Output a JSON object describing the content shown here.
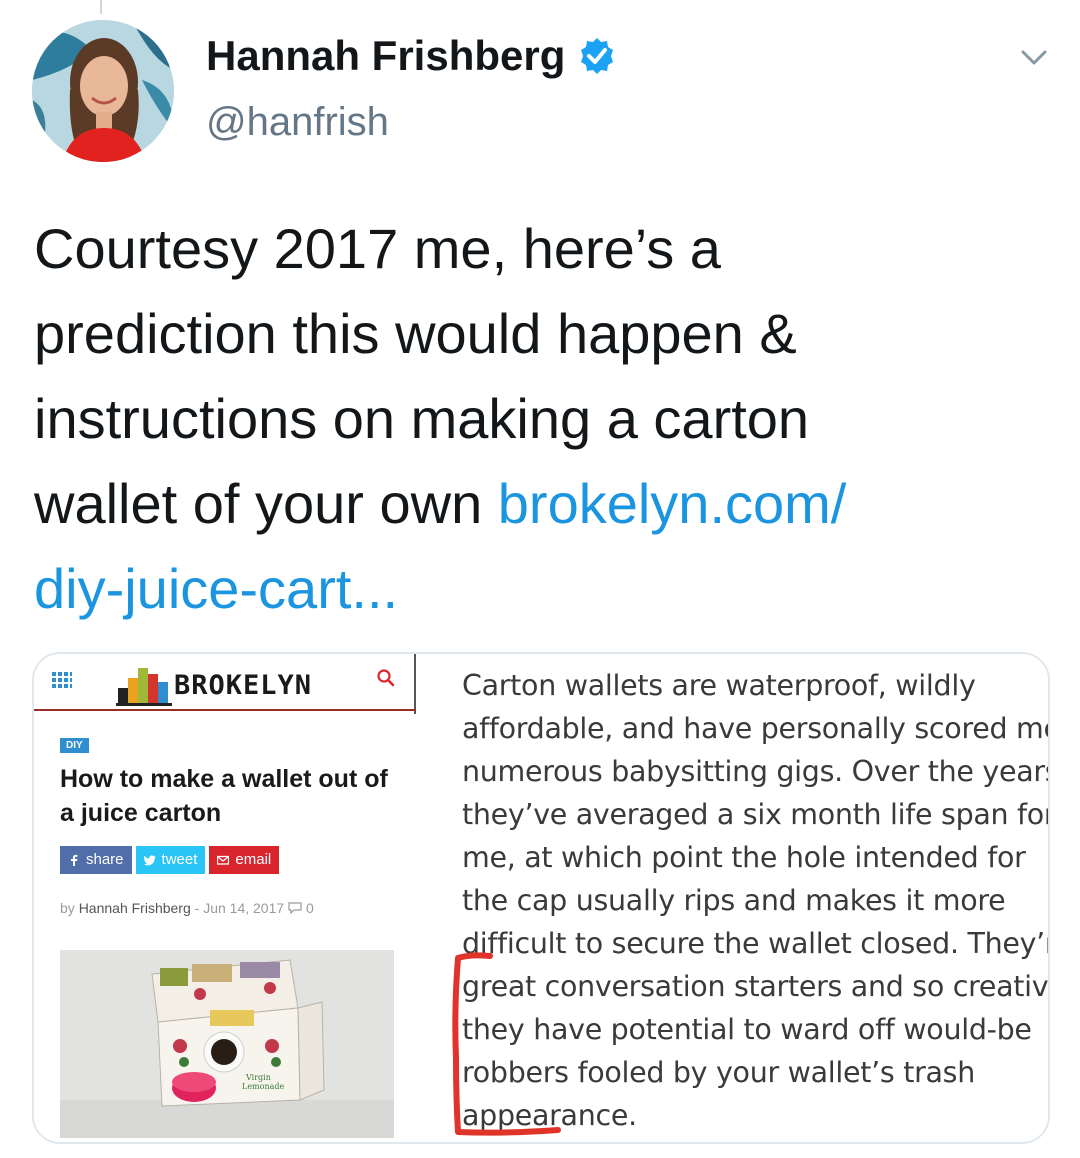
{
  "tweet": {
    "author_name": "Hannah Frishberg",
    "handle": "@hanfrish",
    "text_lines": [
      "Courtesy 2017 me, here’s a",
      "prediction this would happen &",
      "instructions on making a carton",
      "wallet of your own "
    ],
    "link_part1": "brokelyn.com/",
    "link_part2": "diy-juice-cart..."
  },
  "card": {
    "site_name": "BROKELYN",
    "category_badge": "DIY",
    "article_title": "How to make a wallet out of a juice carton",
    "share": {
      "facebook": "share",
      "twitter": "tweet",
      "email": "email"
    },
    "byline_prefix": "by",
    "byline_author": "Hannah Frishberg",
    "byline_date": "- Jun 14, 2017",
    "comment_count": "0",
    "excerpt_lines": [
      "Carton wallets are waterproof, wildly",
      "affordable, and have personally scored me",
      "numerous babysitting gigs. Over the years",
      "they’ve averaged a six month life span for",
      "me, at which point the hole intended for",
      "the cap usually rips and makes it more",
      "difficult to secure the wallet closed. They’re",
      "great conversation starters and so creative",
      "they have potential to ward off would-be",
      "robbers fooled by your wallet’s trash",
      "appearance."
    ]
  },
  "colors": {
    "link": "#1b95e0",
    "verified": "#1da1f2",
    "bracket_annotation": "#e0332a",
    "facebook": "#516eab",
    "twitter": "#29c5f6",
    "email": "#d9262d",
    "diy_badge": "#2f8ed0"
  },
  "icons": [
    "verified-badge-icon",
    "chevron-down-icon",
    "menu-grid-icon",
    "search-icon",
    "facebook-icon",
    "twitter-bird-icon",
    "envelope-icon",
    "comment-icon"
  ]
}
